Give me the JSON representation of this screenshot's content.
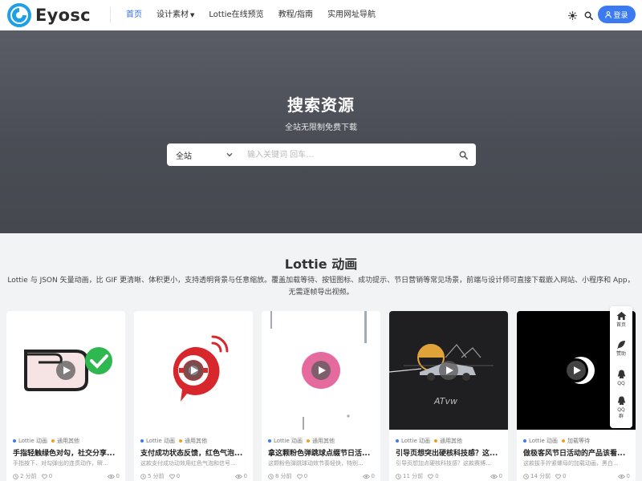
{
  "header": {
    "logo_text": "Eyosc",
    "nav": [
      {
        "label": "首页",
        "active": true,
        "dropdown": false
      },
      {
        "label": "设计素材",
        "active": false,
        "dropdown": true
      },
      {
        "label": "Lottie在线预览",
        "active": false,
        "dropdown": false
      },
      {
        "label": "教程/指南",
        "active": false,
        "dropdown": false
      },
      {
        "label": "实用网址导航",
        "active": false,
        "dropdown": false
      }
    ],
    "theme_icon": "theme-toggle-icon",
    "search_icon": "search-icon",
    "login_label": "登录",
    "accent_color": "#3b7af0"
  },
  "hero": {
    "title": "搜索资源",
    "subtitle": "全站无限制免费下载",
    "search": {
      "category_value": "全站",
      "placeholder": "输入关键词 回车..."
    }
  },
  "section": {
    "title": "Lottie 动画",
    "description": "Lottie 与 JSON 矢量动画，比 GIF 更清晰、体积更小，支持透明背景与任意缩放。覆盖加载等待、按钮图标、成功提示、节日营销等常见场景，前端与设计师可直接下载嵌入网站、小程序和 App，无需逐帧导出视频。"
  },
  "cards": [
    {
      "category": "Lottie 动画",
      "tag": "通用其他",
      "tag_color": "#f0a020",
      "title": "手指轻触绿色对勾，社交分享...",
      "excerpt": "手指按下、对勾弹出的连贯动作，瞬...",
      "time": "2 分前",
      "likes": "0",
      "views": "0"
    },
    {
      "category": "Lottie 动画",
      "tag": "通用其他",
      "tag_color": "#f0a020",
      "title": "支付成功状态反馈，红色气泡...",
      "excerpt": "这款支付成功动效用红色气泡和信号...",
      "time": "5 分前",
      "likes": "0",
      "views": "0"
    },
    {
      "category": "Lottie 动画",
      "tag": "通用其他",
      "tag_color": "#f0a020",
      "title": "拿这颗粉色弹跳球点缀节日活...",
      "excerpt": "这颗粉色弹跳球动效节奏轻快，特别...",
      "time": "8 分前",
      "likes": "0",
      "views": "0"
    },
    {
      "category": "Lottie 动画",
      "tag": "通用其他",
      "tag_color": "#f0a020",
      "title": "引导页想突出硬核科技感？这...",
      "excerpt": "引导页想加点硬核科技感？这款赛博...",
      "time": "11 分前",
      "likes": "0",
      "views": "0"
    },
    {
      "category": "Lottie 动画",
      "tag": "加载等待",
      "tag_color": "#f0a020",
      "title": "做极客风节日活动的产品该看...",
      "excerpt": "这款拔手拧紧螺母的加载动画，黑白...",
      "time": "14 分前",
      "likes": "0",
      "views": "0"
    }
  ],
  "sidebar": [
    {
      "label": "首页",
      "icon": "home-icon"
    },
    {
      "label": "赞助",
      "icon": "feather-icon"
    },
    {
      "label": "QQ",
      "icon": "qq-icon"
    },
    {
      "label": "QQ群",
      "icon": "qq-group-icon"
    }
  ]
}
